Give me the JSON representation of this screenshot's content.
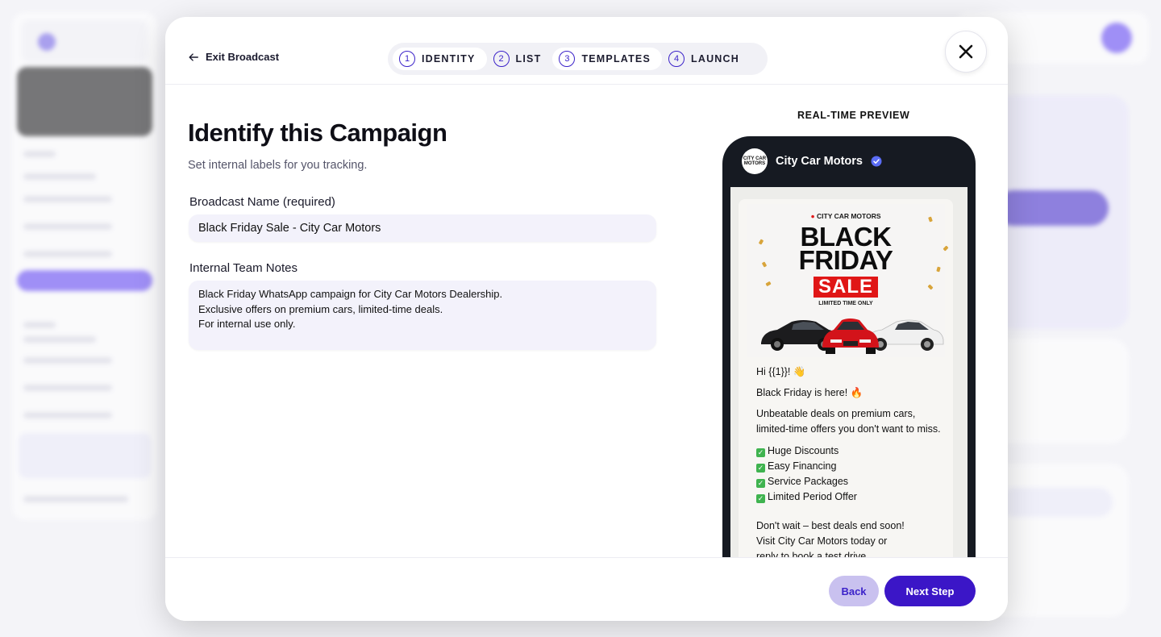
{
  "header": {
    "exit_label": "Exit Broadcast",
    "steps": [
      {
        "num": "1",
        "label": "IDENTITY"
      },
      {
        "num": "2",
        "label": "LIST"
      },
      {
        "num": "3",
        "label": "TEMPLATES"
      },
      {
        "num": "4",
        "label": "LAUNCH"
      }
    ]
  },
  "form": {
    "title": "Identify this Campaign",
    "subtitle": "Set internal labels for you tracking.",
    "name_label": "Broadcast Name (required)",
    "name_value": "Black Friday Sale - City Car Motors",
    "notes_label": "Internal Team Notes",
    "notes_value": "Black Friday WhatsApp campaign for City Car Motors Dealership.\nExclusive offers on premium cars, limited-time deals.\nFor internal use only."
  },
  "preview": {
    "label": "REAL-TIME PREVIEW",
    "logo_text": "CITY CAR MOTORS",
    "brand_name": "City Car Motors",
    "banner_brand": "CITY CAR MOTORS",
    "banner_line1": "BLACK",
    "banner_line2": "FRIDAY",
    "banner_sale": "SALE",
    "banner_limited": "LIMITED TIME ONLY",
    "greeting": "Hi {{1}}! 👋",
    "line_bf": "Black Friday is here! 🔥",
    "line_deals_1": "Unbeatable deals on premium cars,",
    "line_deals_2": "limited-time offers you don't want to miss.",
    "bullets": [
      "Huge Discounts",
      "Easy Financing",
      "Service Packages",
      "Limited Period Offer"
    ],
    "closing_1": "Don't wait – best deals end soon!",
    "closing_2": "Visit City Car Motors today or",
    "closing_3": "reply to book a test drive."
  },
  "footer": {
    "back_label": "Back",
    "next_label": "Next Step"
  },
  "colors": {
    "accent": "#3b16c7",
    "back_bg": "#c9c1ef",
    "phone": "#161a22",
    "sale_red": "#e01616"
  }
}
